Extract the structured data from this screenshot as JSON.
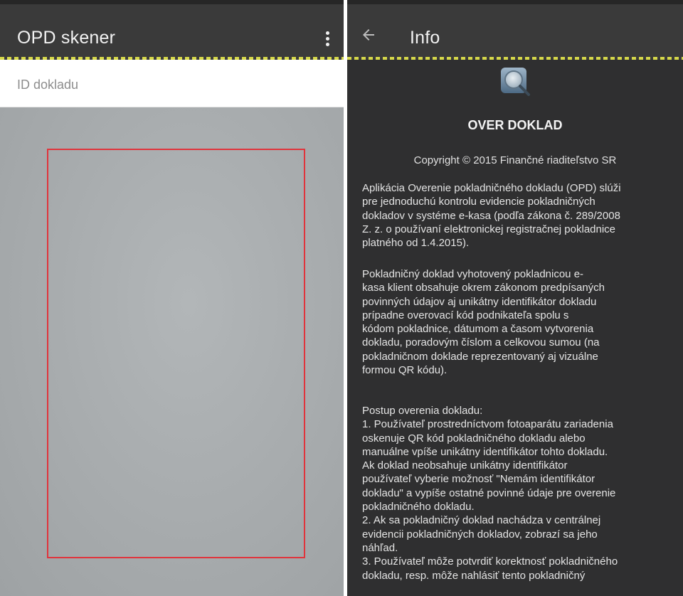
{
  "left_screen": {
    "appbar": {
      "title": "OPD skener"
    },
    "id_field": {
      "placeholder": "ID dokladu",
      "value": ""
    }
  },
  "right_screen": {
    "appbar": {
      "title": "Info"
    },
    "app_name": "OVER DOKLAD",
    "copyright": "Copyright © 2015 Finančné riaditeľstvo SR",
    "paragraph_1": [
      "Aplikácia Overenie pokladničného dokladu (OPD) slúži",
      "pre jednoduchú kontrolu evidencie pokladničných",
      "dokladov v systéme e-kasa (podľa zákona č. 289/2008",
      "Z. z. o používaní elektronickej registračnej pokladnice",
      "platného od 1.4.2015)."
    ],
    "paragraph_2": [
      "Pokladničný doklad vyhotovený pokladnicou e-",
      "kasa klient obsahuje okrem zákonom predpísaných",
      "povinných údajov aj unikátny identifikátor dokladu",
      "prípadne overovací kód podnikateľa spolu s",
      "kódom pokladnice, dátumom a časom vytvorenia",
      "dokladu, poradovým číslom a celkovou sumou (na",
      "pokladničnom doklade reprezentovaný aj vizuálne",
      "formou QR kódu)."
    ],
    "paragraph_3": [
      "Postup overenia dokladu:",
      "1. Používateľ prostredníctvom fotoaparátu zariadenia",
      "oskenuje QR kód pokladničného dokladu alebo",
      "manuálne vpíše unikátny identifikátor tohto dokladu.",
      "Ak doklad neobsahuje unikátny identifikátor",
      "používateľ vyberie možnosť \"Nemám identifikátor",
      "dokladu\" a vypíše ostatné povinné údaje pre overenie",
      "pokladničného dokladu.",
      "2. Ak sa pokladničný doklad nachádza v centrálnej",
      "evidencii pokladničných dokladov, zobrazí sa jeho",
      "náhľad.",
      "3. Používateľ môže potvrdiť korektnosť pokladničného",
      "dokladu, resp. môže nahlásiť tento pokladničný"
    ]
  },
  "colors": {
    "appbar": "#3a3a3a",
    "accent_dash": "#d6d84a",
    "scan_frame": "#e0343c",
    "info_background": "#2f2f30"
  },
  "icons": {
    "overflow": "more-vert-icon",
    "back": "arrow-back-icon",
    "app": "magnifier-app-icon"
  }
}
